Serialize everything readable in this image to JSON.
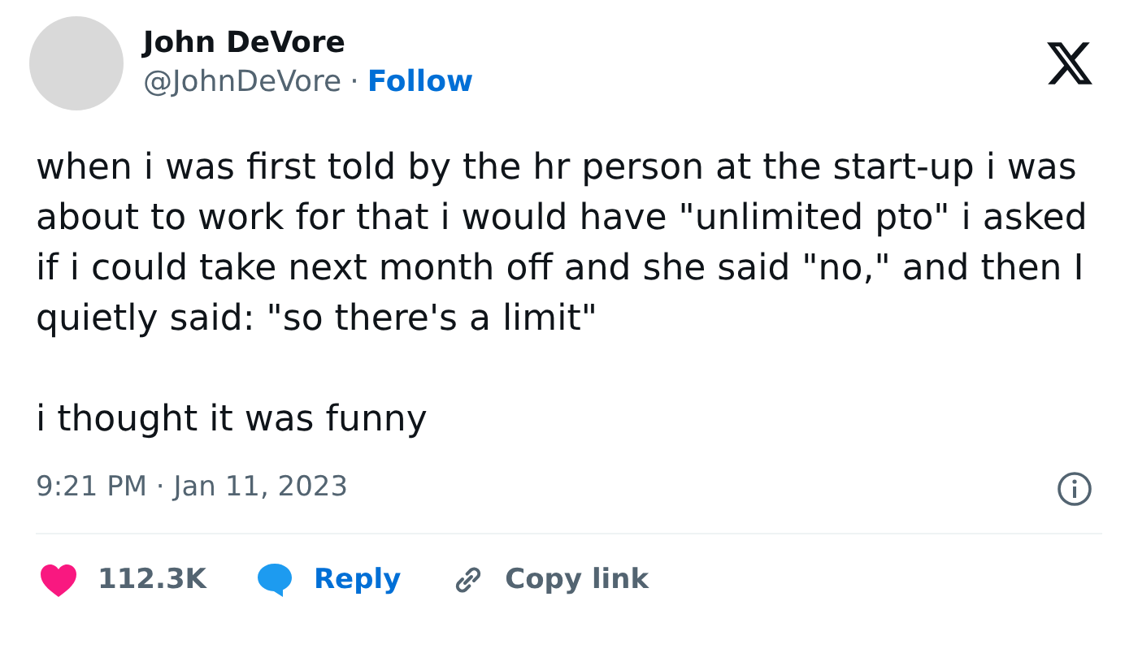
{
  "author": {
    "name": "John DeVore",
    "handle": "@JohnDeVore",
    "separator": "·",
    "follow": "Follow"
  },
  "paragraphs": [
    "when i was first told by the hr person at the start-up i was about to work for that i would have \"unlimited pto\" i asked if i could take next month off and she said \"no,\" and then I quietly said: \"so there's a limit\"",
    "i thought it was funny"
  ],
  "timestamp": "9:21 PM · Jan 11, 2023",
  "actions": [
    {
      "kind": "like",
      "label": "112.3K"
    },
    {
      "kind": "reply",
      "label": "Reply"
    },
    {
      "kind": "copy",
      "label": "Copy link"
    }
  ]
}
